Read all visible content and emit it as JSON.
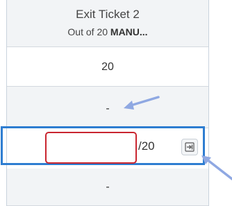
{
  "column": {
    "title": "Exit Ticket 2",
    "subtitle_prefix": "Out of 20 ",
    "subtitle_bold": "MANU..."
  },
  "rows": {
    "score_value": "20",
    "dash_1": "-",
    "active": {
      "input_value": "",
      "out_of": "/20"
    },
    "dash_2": "-"
  },
  "icons": {
    "submit": "arrow-into-box-icon",
    "annotation_arrows": "callout-arrow"
  },
  "colors": {
    "active_border": "#2e7dd1",
    "input_border": "#c9252f",
    "annotation_arrow": "#8fa8e2",
    "header_bg": "#f2f4f6"
  }
}
